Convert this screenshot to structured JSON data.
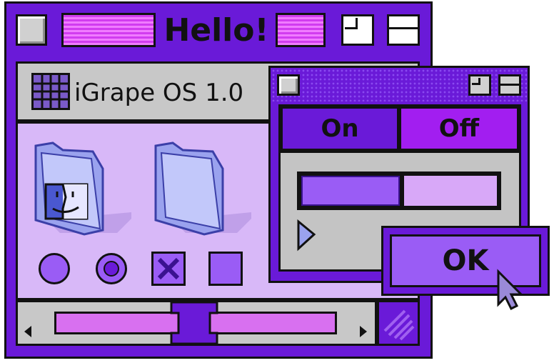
{
  "main_window": {
    "title": "Hello!",
    "toolbar_label": "iGrape OS 1.0"
  },
  "dialog": {
    "toggle_on_label": "On",
    "toggle_off_label": "Off",
    "ok_label": "OK"
  },
  "icons": {
    "app_grid": "grid-icon",
    "finder_folder": "finder-folder-icon",
    "folder": "folder-icon",
    "cursor": "arrow-cursor-icon"
  },
  "colors": {
    "window_frame": "#6a1ad8",
    "title_stripes": "#d23cf0",
    "content_bg": "#d8b8f8",
    "accent": "#9a5cf5",
    "chrome": "#c4c4c4"
  }
}
